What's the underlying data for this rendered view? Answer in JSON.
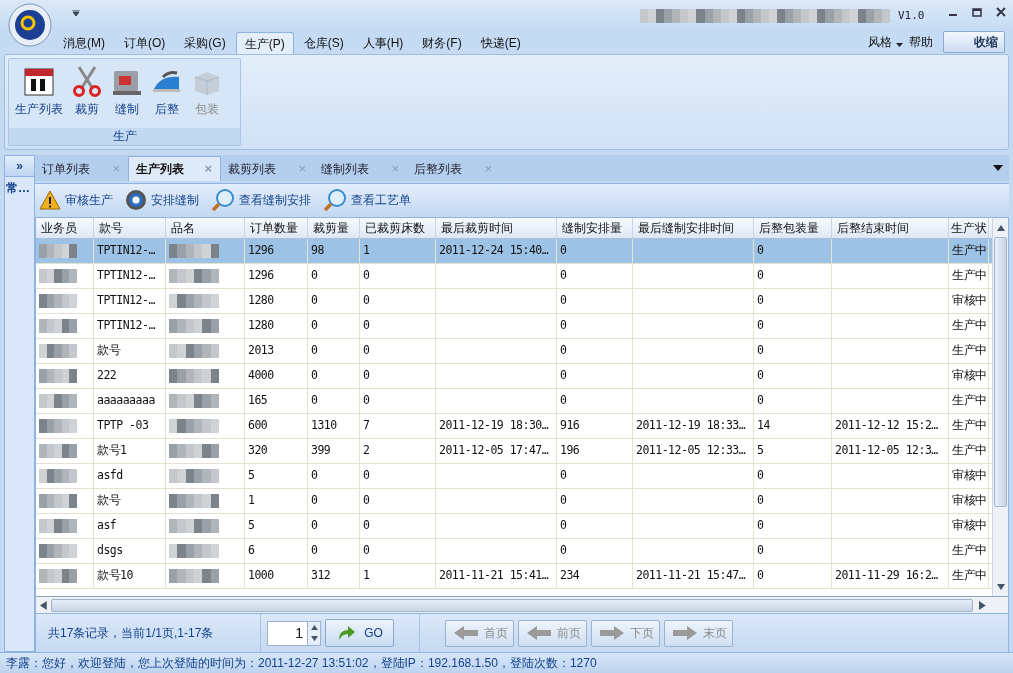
{
  "window": {
    "version": "V1.0"
  },
  "menu": [
    {
      "label": "消息(M)",
      "selected": false
    },
    {
      "label": "订单(O)",
      "selected": false
    },
    {
      "label": "采购(G)",
      "selected": false
    },
    {
      "label": "生产(P)",
      "selected": true
    },
    {
      "label": "仓库(S)",
      "selected": false
    },
    {
      "label": "人事(H)",
      "selected": false
    },
    {
      "label": "财务(F)",
      "selected": false
    },
    {
      "label": "快递(E)",
      "selected": false
    }
  ],
  "menu_right": {
    "style": "风格",
    "help": "帮助",
    "collapse": "收缩"
  },
  "ribbon": {
    "group": "生产",
    "buttons": [
      {
        "label": "生产列表",
        "kind": "calendar",
        "disabled": false
      },
      {
        "label": "裁剪",
        "kind": "scissors",
        "disabled": false
      },
      {
        "label": "缝制",
        "kind": "sewing",
        "disabled": false
      },
      {
        "label": "后整",
        "kind": "iron",
        "disabled": false
      },
      {
        "label": "包装",
        "kind": "box",
        "disabled": true
      }
    ]
  },
  "sidebar": {
    "toggle": "»",
    "item": "常…"
  },
  "tabs": [
    {
      "label": "订单列表",
      "selected": false,
      "close": "×"
    },
    {
      "label": "生产列表",
      "selected": true,
      "close": "×"
    },
    {
      "label": "裁剪列表",
      "selected": false,
      "close": "×"
    },
    {
      "label": "缝制列表",
      "selected": false,
      "close": "×"
    },
    {
      "label": "后整列表",
      "selected": false,
      "close": "×"
    }
  ],
  "toolbar": [
    {
      "label": "审核生产",
      "kind": "warning"
    },
    {
      "label": "安排缝制",
      "kind": "gear"
    },
    {
      "label": "查看缝制安排",
      "kind": "search"
    },
    {
      "label": "查看工艺单",
      "kind": "search"
    }
  ],
  "table": {
    "columns": [
      "业务员",
      "款号",
      "品名",
      "订单数量",
      "裁剪量",
      "已裁剪床数",
      "最后裁剪时间",
      "缝制安排量",
      "最后缝制安排时间",
      "后整包装量",
      "后整结束时间",
      "生产状"
    ],
    "rows": [
      {
        "selected": true,
        "cells": [
          "",
          "TPTIN12-…",
          "",
          "1296",
          "98",
          "1",
          "2011-12-24  15:40…",
          "0",
          "",
          "0",
          "",
          "生产中"
        ]
      },
      {
        "selected": false,
        "cells": [
          "",
          "TPTIN12-…",
          "",
          "1296",
          "0",
          "0",
          "",
          "0",
          "",
          "0",
          "",
          "生产中"
        ]
      },
      {
        "selected": false,
        "cells": [
          "",
          "TPTIN12-…",
          "",
          "1280",
          "0",
          "0",
          "",
          "0",
          "",
          "0",
          "",
          "审核中"
        ]
      },
      {
        "selected": false,
        "cells": [
          "",
          "TPTIN12-…",
          "",
          "1280",
          "0",
          "0",
          "",
          "0",
          "",
          "0",
          "",
          "生产中"
        ]
      },
      {
        "selected": false,
        "cells": [
          "",
          "款号",
          "",
          "2013",
          "0",
          "0",
          "",
          "0",
          "",
          "0",
          "",
          "生产中"
        ]
      },
      {
        "selected": false,
        "cells": [
          "",
          "222",
          "",
          "4000",
          "0",
          "0",
          "",
          "0",
          "",
          "0",
          "",
          "审核中"
        ]
      },
      {
        "selected": false,
        "cells": [
          "",
          "aaaaaaaaa",
          "",
          "165",
          "0",
          "0",
          "",
          "0",
          "",
          "0",
          "",
          "生产中"
        ]
      },
      {
        "selected": false,
        "cells": [
          "",
          "TPTP -03",
          "",
          "600",
          "1310",
          "7",
          "2011-12-19  18:30…",
          "916",
          "2011-12-19  18:33…",
          "14",
          "2011-12-12  15:2…",
          "生产中"
        ]
      },
      {
        "selected": false,
        "cells": [
          "",
          "款号1",
          "",
          "320",
          "399",
          "2",
          "2011-12-05  17:47…",
          "196",
          "2011-12-05  12:33…",
          "5",
          "2011-12-05  12:3…",
          "生产中"
        ]
      },
      {
        "selected": false,
        "cells": [
          "",
          "asfd",
          "",
          "5",
          "0",
          "0",
          "",
          "0",
          "",
          "0",
          "",
          "审核中"
        ]
      },
      {
        "selected": false,
        "cells": [
          "",
          "款号",
          "",
          "1",
          "0",
          "0",
          "",
          "0",
          "",
          "0",
          "",
          "审核中"
        ]
      },
      {
        "selected": false,
        "cells": [
          "",
          "asf",
          "",
          "5",
          "0",
          "0",
          "",
          "0",
          "",
          "0",
          "",
          "审核中"
        ]
      },
      {
        "selected": false,
        "cells": [
          "",
          "dsgs",
          "",
          "6",
          "0",
          "0",
          "",
          "0",
          "",
          "0",
          "",
          "生产中"
        ]
      },
      {
        "selected": false,
        "cells": [
          "",
          "款号10",
          "",
          "1000",
          "312",
          "1",
          "2011-11-21  15:41…",
          "234",
          "2011-11-21  15:47…",
          "0",
          "2011-11-29  16:2…",
          "生产中"
        ]
      }
    ]
  },
  "pager": {
    "summary": "共17条记录，当前1/1页,1-17条",
    "page": "1",
    "go": "GO",
    "buttons": [
      {
        "label": "首页",
        "kind": "left",
        "disabled": true
      },
      {
        "label": "前页",
        "kind": "left",
        "disabled": true
      },
      {
        "label": "下页",
        "kind": "right",
        "disabled": true
      },
      {
        "label": "末页",
        "kind": "right",
        "disabled": true
      }
    ]
  },
  "status_bar": "李露：您好，欢迎登陆，您上次登陆的时间为：2011-12-27  13:51:02，登陆IP：192.168.1.50，登陆次数：1270"
}
